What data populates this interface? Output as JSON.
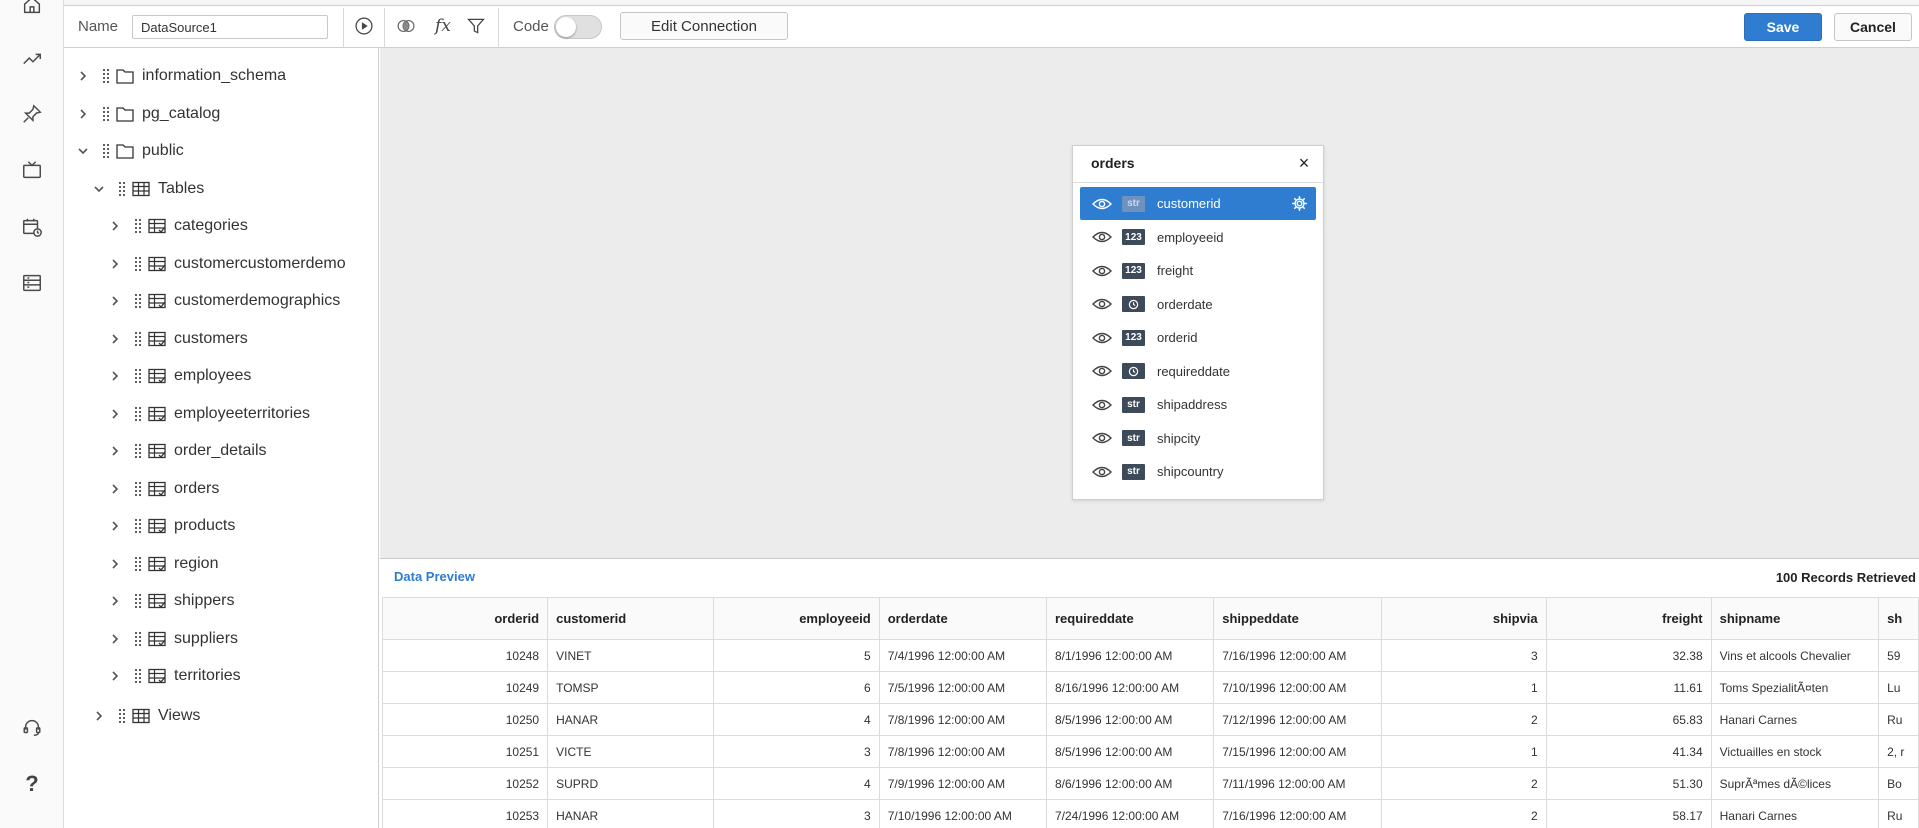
{
  "toolbar": {
    "name_label": "Name",
    "name_value": "DataSource1",
    "code_label": "Code",
    "edit_connection_label": "Edit Connection",
    "save_label": "Save",
    "cancel_label": "Cancel",
    "code_toggle_on": false
  },
  "tree": {
    "schemas": [
      {
        "label": "information_schema"
      },
      {
        "label": "pg_catalog"
      },
      {
        "label": "public"
      }
    ],
    "tables_label": "Tables",
    "tables": [
      {
        "label": "categories"
      },
      {
        "label": "customercustomerdemo"
      },
      {
        "label": "customerdemographics"
      },
      {
        "label": "customers"
      },
      {
        "label": "employees"
      },
      {
        "label": "employeeterritories"
      },
      {
        "label": "order_details"
      },
      {
        "label": "orders"
      },
      {
        "label": "products"
      },
      {
        "label": "region"
      },
      {
        "label": "shippers"
      },
      {
        "label": "suppliers"
      },
      {
        "label": "territories"
      }
    ],
    "views_label": "Views"
  },
  "card": {
    "title": "orders",
    "fields": [
      {
        "type": "str",
        "name": "customerid",
        "selected": true
      },
      {
        "type": "123",
        "name": "employeeid"
      },
      {
        "type": "123",
        "name": "freight"
      },
      {
        "type": "clock-icon",
        "name": "orderdate"
      },
      {
        "type": "123",
        "name": "orderid"
      },
      {
        "type": "clock-icon",
        "name": "requireddate"
      },
      {
        "type": "str",
        "name": "shipaddress"
      },
      {
        "type": "str",
        "name": "shipcity"
      },
      {
        "type": "str",
        "name": "shipcountry"
      }
    ]
  },
  "preview": {
    "title": "Data Preview",
    "count": "100 Records Retrieved",
    "columns": [
      "orderid",
      "customerid",
      "employeeid",
      "orderdate",
      "requireddate",
      "shippeddate",
      "shipvia",
      "freight",
      "shipname",
      "sh"
    ],
    "rows": [
      [
        "10248",
        "VINET",
        "5",
        "7/4/1996 12:00:00 AM",
        "8/1/1996 12:00:00 AM",
        "7/16/1996 12:00:00 AM",
        "3",
        "32.38",
        "Vins et alcools Chevalier",
        "59"
      ],
      [
        "10249",
        "TOMSP",
        "6",
        "7/5/1996 12:00:00 AM",
        "8/16/1996 12:00:00 AM",
        "7/10/1996 12:00:00 AM",
        "1",
        "11.61",
        "Toms SpezialitÃ¤ten",
        "Lu"
      ],
      [
        "10250",
        "HANAR",
        "4",
        "7/8/1996 12:00:00 AM",
        "8/5/1996 12:00:00 AM",
        "7/12/1996 12:00:00 AM",
        "2",
        "65.83",
        "Hanari Carnes",
        "Ru"
      ],
      [
        "10251",
        "VICTE",
        "3",
        "7/8/1996 12:00:00 AM",
        "8/5/1996 12:00:00 AM",
        "7/15/1996 12:00:00 AM",
        "1",
        "41.34",
        "Victuailles en stock",
        "2, r"
      ],
      [
        "10252",
        "SUPRD",
        "4",
        "7/9/1996 12:00:00 AM",
        "8/6/1996 12:00:00 AM",
        "7/11/1996 12:00:00 AM",
        "2",
        "51.30",
        "SuprÃªmes dÃ©lices",
        "Bo"
      ],
      [
        "10253",
        "HANAR",
        "3",
        "7/10/1996 12:00:00 AM",
        "7/24/1996 12:00:00 AM",
        "7/16/1996 12:00:00 AM",
        "2",
        "58.17",
        "Hanari Carnes",
        "Ru"
      ]
    ]
  },
  "colors": {
    "accent": "#2e7dd1",
    "canvas": "#ececec",
    "badge": "#3d4a5a"
  }
}
